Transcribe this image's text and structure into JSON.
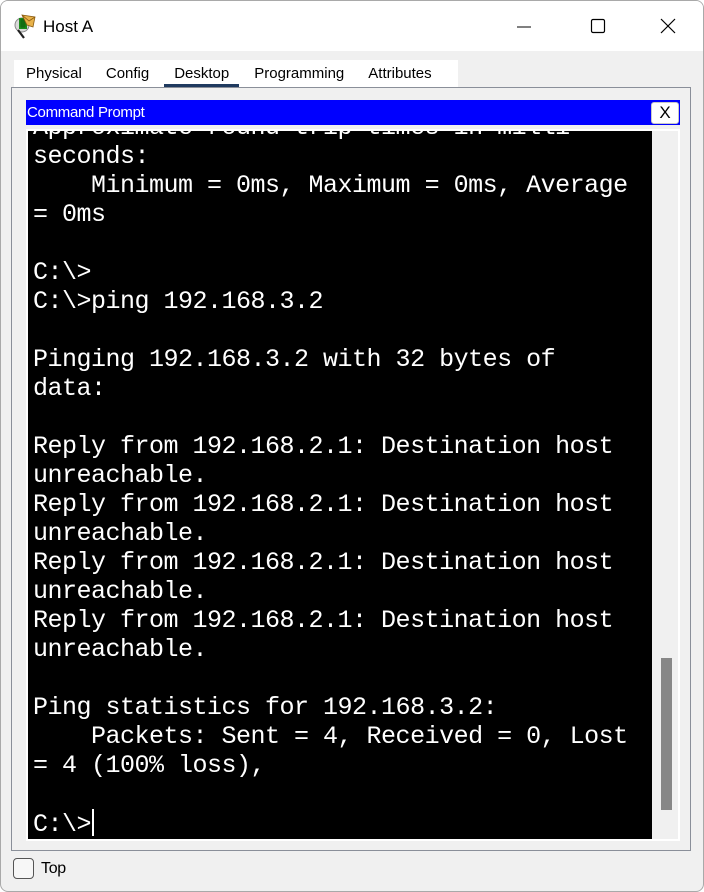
{
  "window": {
    "title": "Host A",
    "icon": "packet-tracer-host-icon",
    "controls": {
      "minimize_icon": "minimize-icon",
      "maximize_icon": "maximize-icon",
      "close_icon": "close-icon"
    }
  },
  "tabs": [
    {
      "label": "Physical",
      "active": false
    },
    {
      "label": "Config",
      "active": false
    },
    {
      "label": "Desktop",
      "active": true
    },
    {
      "label": "Programming",
      "active": false
    },
    {
      "label": "Attributes",
      "active": false
    }
  ],
  "command_prompt": {
    "title": "Command Prompt",
    "close_label": "X",
    "colors": {
      "header": "#0000ff",
      "background": "#000000",
      "text": "#ffffff"
    },
    "lines": [
      "Approximate round trip times in milli-",
      "seconds:",
      "    Minimum = 0ms, Maximum = 0ms, Average",
      "= 0ms",
      "",
      "C:\\>",
      "C:\\>ping 192.168.3.2",
      "",
      "Pinging 192.168.3.2 with 32 bytes of",
      "data:",
      "",
      "Reply from 192.168.2.1: Destination host",
      "unreachable.",
      "Reply from 192.168.2.1: Destination host",
      "unreachable.",
      "Reply from 192.168.2.1: Destination host",
      "unreachable.",
      "Reply from 192.168.2.1: Destination host",
      "unreachable.",
      "",
      "Ping statistics for 192.168.3.2:",
      "    Packets: Sent = 4, Received = 0, Lost",
      "= 4 (100% loss),",
      ""
    ],
    "prompt": "C:\\>",
    "scroll": {
      "thumb_start_fraction": 0.745,
      "thumb_size_fraction": 0.215
    }
  },
  "footer": {
    "top_checkbox_label": "Top",
    "top_checked": false
  }
}
